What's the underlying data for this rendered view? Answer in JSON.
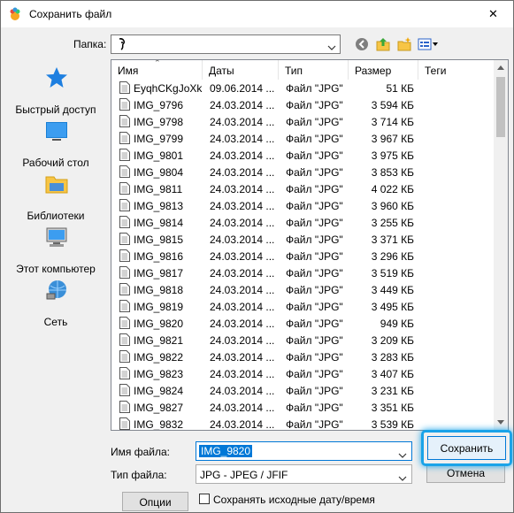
{
  "window": {
    "title": "Сохранить файл",
    "close_symbol": "✕"
  },
  "folder": {
    "label": "Папка:",
    "current_value": ""
  },
  "places": [
    {
      "label": "Быстрый доступ",
      "icon": "star-icon"
    },
    {
      "label": "Рабочий стол",
      "icon": "desktop-icon"
    },
    {
      "label": "Библиотеки",
      "icon": "libraries-icon"
    },
    {
      "label": "Этот компьютер",
      "icon": "computer-icon"
    },
    {
      "label": "Сеть",
      "icon": "network-icon"
    }
  ],
  "columns": {
    "name": "Имя",
    "date": "Даты",
    "type": "Тип",
    "size": "Размер",
    "tags": "Теги"
  },
  "files": [
    {
      "name": "EyqhCKgJoXk",
      "date": "09.06.2014 ...",
      "type": "Файл \"JPG\"",
      "size": "51 КБ"
    },
    {
      "name": "IMG_9796",
      "date": "24.03.2014 ...",
      "type": "Файл \"JPG\"",
      "size": "3 594 КБ"
    },
    {
      "name": "IMG_9798",
      "date": "24.03.2014 ...",
      "type": "Файл \"JPG\"",
      "size": "3 714 КБ"
    },
    {
      "name": "IMG_9799",
      "date": "24.03.2014 ...",
      "type": "Файл \"JPG\"",
      "size": "3 967 КБ"
    },
    {
      "name": "IMG_9801",
      "date": "24.03.2014 ...",
      "type": "Файл \"JPG\"",
      "size": "3 975 КБ"
    },
    {
      "name": "IMG_9804",
      "date": "24.03.2014 ...",
      "type": "Файл \"JPG\"",
      "size": "3 853 КБ"
    },
    {
      "name": "IMG_9811",
      "date": "24.03.2014 ...",
      "type": "Файл \"JPG\"",
      "size": "4 022 КБ"
    },
    {
      "name": "IMG_9813",
      "date": "24.03.2014 ...",
      "type": "Файл \"JPG\"",
      "size": "3 960 КБ"
    },
    {
      "name": "IMG_9814",
      "date": "24.03.2014 ...",
      "type": "Файл \"JPG\"",
      "size": "3 255 КБ"
    },
    {
      "name": "IMG_9815",
      "date": "24.03.2014 ...",
      "type": "Файл \"JPG\"",
      "size": "3 371 КБ"
    },
    {
      "name": "IMG_9816",
      "date": "24.03.2014 ...",
      "type": "Файл \"JPG\"",
      "size": "3 296 КБ"
    },
    {
      "name": "IMG_9817",
      "date": "24.03.2014 ...",
      "type": "Файл \"JPG\"",
      "size": "3 519 КБ"
    },
    {
      "name": "IMG_9818",
      "date": "24.03.2014 ...",
      "type": "Файл \"JPG\"",
      "size": "3 449 КБ"
    },
    {
      "name": "IMG_9819",
      "date": "24.03.2014 ...",
      "type": "Файл \"JPG\"",
      "size": "3 495 КБ"
    },
    {
      "name": "IMG_9820",
      "date": "24.03.2014 ...",
      "type": "Файл \"JPG\"",
      "size": "949 КБ"
    },
    {
      "name": "IMG_9821",
      "date": "24.03.2014 ...",
      "type": "Файл \"JPG\"",
      "size": "3 209 КБ"
    },
    {
      "name": "IMG_9822",
      "date": "24.03.2014 ...",
      "type": "Файл \"JPG\"",
      "size": "3 283 КБ"
    },
    {
      "name": "IMG_9823",
      "date": "24.03.2014 ...",
      "type": "Файл \"JPG\"",
      "size": "3 407 КБ"
    },
    {
      "name": "IMG_9824",
      "date": "24.03.2014 ...",
      "type": "Файл \"JPG\"",
      "size": "3 231 КБ"
    },
    {
      "name": "IMG_9827",
      "date": "24.03.2014 ...",
      "type": "Файл \"JPG\"",
      "size": "3 351 КБ"
    },
    {
      "name": "IMG_9832",
      "date": "24.03.2014 ...",
      "type": "Файл \"JPG\"",
      "size": "3 539 КБ"
    }
  ],
  "filename": {
    "label": "Имя файла:",
    "value": "IMG_9820"
  },
  "filetype": {
    "label": "Тип файла:",
    "value": "JPG - JPEG / JFIF"
  },
  "buttons": {
    "save": "Сохранить",
    "cancel": "Отмена",
    "options": "Опции"
  },
  "keep_original": {
    "label": "Сохранять исходные дату/время",
    "checked": false
  },
  "colors": {
    "accent": "#0078d7",
    "highlight": "#1aa3e8",
    "folder_yellow": "#f7c545"
  }
}
